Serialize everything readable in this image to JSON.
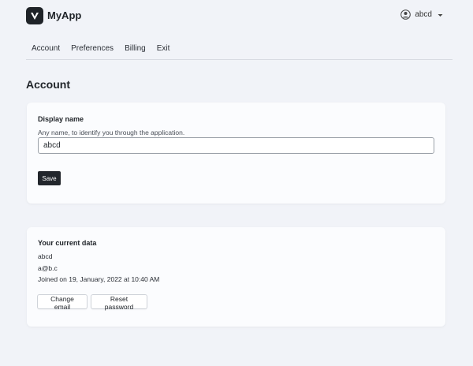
{
  "app": {
    "name": "MyApp"
  },
  "user_menu": {
    "username": "abcd"
  },
  "nav": {
    "items": [
      {
        "label": "Account"
      },
      {
        "label": "Preferences"
      },
      {
        "label": "Billing"
      },
      {
        "label": "Exit"
      }
    ]
  },
  "page": {
    "title": "Account"
  },
  "display_name_card": {
    "heading": "Display name",
    "hint": "Any name, to identify you through the application.",
    "input_value": "abcd",
    "save_label": "Save"
  },
  "current_data_card": {
    "heading": "Your current data",
    "name": "abcd",
    "email": "a@b.c",
    "joined": "Joined on 19, January, 2022 at 10:40 AM",
    "change_email_label": "Change email",
    "reset_password_label": "Reset password"
  },
  "icons": {
    "logo": "app-logo-icon",
    "avatar": "user-circle-icon",
    "dropdown": "chevron-down-icon"
  },
  "colors": {
    "background": "#f1f3f8",
    "card": "#fbfcfe",
    "primary_button": "#22262c"
  }
}
